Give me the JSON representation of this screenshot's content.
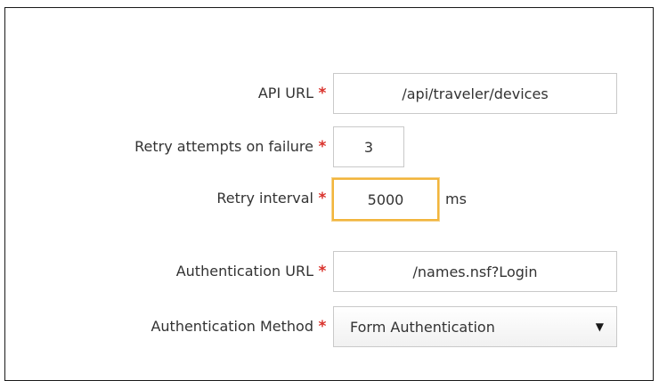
{
  "form": {
    "api_url": {
      "label": "API URL",
      "required_mark": "*",
      "value": "/api/traveler/devices"
    },
    "retry_attempts": {
      "label": "Retry attempts on failure",
      "required_mark": "*",
      "value": "3"
    },
    "retry_interval": {
      "label": "Retry interval",
      "required_mark": "*",
      "value": "5000",
      "unit": "ms"
    },
    "auth_url": {
      "label": "Authentication URL",
      "required_mark": "*",
      "value": "/names.nsf?Login"
    },
    "auth_method": {
      "label": "Authentication Method",
      "required_mark": "*",
      "selected": "Form Authentication",
      "arrow": "▼"
    }
  },
  "colors": {
    "required": "#d9312b",
    "focus_border": "#f2b53c",
    "field_border": "#c9c9c9",
    "panel_border": "#1a1a1a"
  },
  "icons": {
    "required": "asterisk-icon",
    "dropdown": "dropdown-arrow-icon"
  }
}
